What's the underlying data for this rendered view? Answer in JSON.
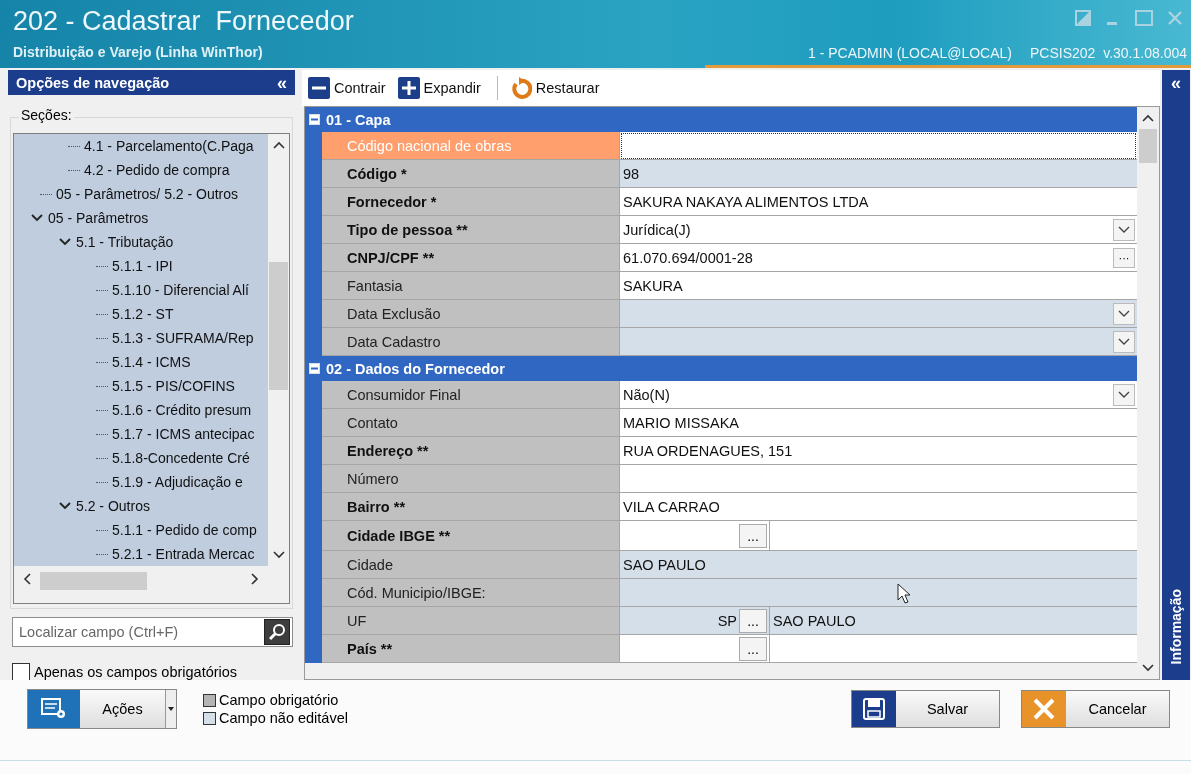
{
  "window": {
    "title": "202 - Cadastrar  Fornecedor",
    "subtitle": "Distribuição e Varejo (Linha WinThor)",
    "session": "1 - PCADMIN (LOCAL@LOCAL)",
    "version": "PCSIS202  v.30.1.08.004"
  },
  "nav": {
    "title": "Opções de navegação",
    "collapse": "«",
    "sections_label": "Seções:",
    "tree": [
      {
        "children": [
          {
            "label": "4.1 - Parcelamento(C.Paga"
          },
          {
            "label": "4.2 - Pedido de compra"
          }
        ]
      },
      {
        "label": "05 - Parâmetros/ 5.2 - Outros"
      },
      {
        "label": "05 - Parâmetros",
        "expanded": true,
        "children": [
          {
            "label": "5.1 - Tributação",
            "expanded": true,
            "children": [
              {
                "label": "5.1.1 - IPI"
              },
              {
                "label": "5.1.10 - Diferencial Alí"
              },
              {
                "label": "5.1.2 - ST"
              },
              {
                "label": "5.1.3 - SUFRAMA/Rep"
              },
              {
                "label": "5.1.4 - ICMS"
              },
              {
                "label": "5.1.5 - PIS/COFINS"
              },
              {
                "label": "5.1.6 - Crédito presum"
              },
              {
                "label": "5.1.7 - ICMS antecipac"
              },
              {
                "label": "5.1.8-Concedente Cré"
              },
              {
                "label": "5.1.9 - Adjudicação e"
              }
            ]
          },
          {
            "label": "5.2 - Outros",
            "expanded": true,
            "children": [
              {
                "label": "5.1.1 - Pedido de comp"
              },
              {
                "label": "5.2.1 - Entrada Mercac"
              }
            ]
          }
        ]
      }
    ],
    "search": {
      "placeholder": "Localizar campo (Ctrl+F)"
    },
    "only_required": {
      "label": "Apenas os campos obrigatórios",
      "checked": false
    }
  },
  "toolbar": [
    {
      "kind": "collapse",
      "label": "Contrair"
    },
    {
      "kind": "expand",
      "label": "Expandir"
    },
    {
      "kind": "restore",
      "label": "Restaurar"
    }
  ],
  "grid": {
    "groups": [
      {
        "title": "01 - Capa",
        "expanded": true,
        "rows": [
          {
            "label": "Código nacional de obras",
            "required": false,
            "editable": true,
            "selected": true,
            "kind": "text"
          },
          {
            "label": "Código *",
            "required": true,
            "editable": false,
            "selected": false,
            "kind": "text",
            "value": "98"
          },
          {
            "label": "Fornecedor *",
            "required": true,
            "editable": true,
            "selected": false,
            "kind": "text",
            "value": "SAKURA NAKAYA ALIMENTOS LTDA"
          },
          {
            "label": "Tipo de pessoa **",
            "required": true,
            "editable": true,
            "selected": false,
            "kind": "combo",
            "value": "Jurídica(J)"
          },
          {
            "label": "CNPJ/CPF **",
            "required": true,
            "editable": true,
            "selected": false,
            "kind": "ellipsis",
            "value": "61.070.694/0001-28",
            "button": "···"
          },
          {
            "label": "Fantasia",
            "required": false,
            "editable": true,
            "selected": false,
            "kind": "text",
            "value": "SAKURA"
          },
          {
            "label": "Data Exclusão",
            "required": false,
            "editable": false,
            "selected": false,
            "kind": "combo"
          },
          {
            "label": "Data Cadastro",
            "required": false,
            "editable": false,
            "selected": false,
            "kind": "combo"
          }
        ]
      },
      {
        "title": "02 - Dados do Fornecedor",
        "expanded": true,
        "rows": [
          {
            "label": "Consumidor Final",
            "required": false,
            "editable": true,
            "selected": false,
            "kind": "combo",
            "value": "Não(N)"
          },
          {
            "label": "Contato",
            "required": false,
            "editable": true,
            "selected": false,
            "kind": "text",
            "value": "MARIO MISSAKA"
          },
          {
            "label": "Endereço **",
            "required": true,
            "editable": true,
            "selected": false,
            "kind": "text",
            "value": "RUA ORDENAGUES, 151"
          },
          {
            "label": "Número",
            "required": false,
            "editable": true,
            "selected": false,
            "kind": "text"
          },
          {
            "label": "Bairro **",
            "required": true,
            "editable": true,
            "selected": false,
            "kind": "text",
            "value": "VILA CARRAO"
          },
          {
            "label": "Cidade IBGE **",
            "required": true,
            "editable": true,
            "selected": false,
            "kind": "lookup",
            "button": "..."
          },
          {
            "label": "Cidade",
            "required": false,
            "editable": false,
            "selected": false,
            "kind": "text",
            "value": "SAO PAULO"
          },
          {
            "label": "Cód. Municipio/IBGE:",
            "required": false,
            "editable": false,
            "selected": false,
            "kind": "text"
          },
          {
            "label": "UF",
            "required": false,
            "editable": false,
            "selected": false,
            "kind": "lookup",
            "value": "SP",
            "button": "...",
            "value2": "SAO PAULO"
          },
          {
            "label": "País **",
            "required": true,
            "editable": true,
            "selected": false,
            "kind": "lookup",
            "button": "..."
          }
        ]
      }
    ]
  },
  "info_panel": {
    "collapse": "«",
    "label": "Informação"
  },
  "footer": {
    "actions": {
      "label": "Ações"
    },
    "legend": [
      {
        "kind": "required",
        "label": "Campo obrigatório"
      },
      {
        "kind": "readonly",
        "label": "Campo não editável"
      }
    ],
    "buttons": [
      {
        "kind": "save",
        "label": "Salvar"
      },
      {
        "kind": "cancel",
        "label": "Cancelar"
      }
    ]
  }
}
